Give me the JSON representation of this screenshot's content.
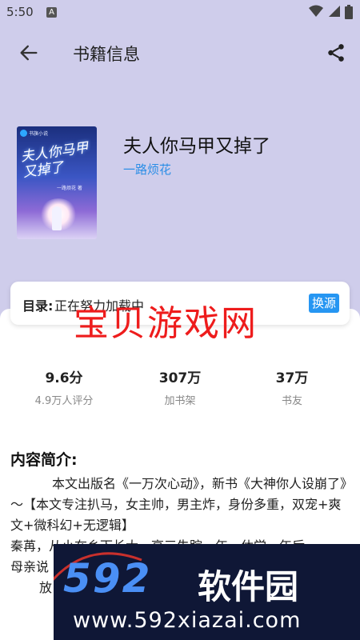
{
  "status_bar": {
    "time": "5:50",
    "notif_letter": "A"
  },
  "app_bar": {
    "title": "书籍信息"
  },
  "book": {
    "title": "夫人你马甲又掉了",
    "author": "一路烦花",
    "cover": {
      "badge_text": "书旗小说",
      "title": "夫人你马甲又掉了",
      "author": "一路烦花 著"
    }
  },
  "toc": {
    "label": "目录:",
    "status": "正在努力加载中",
    "switch_label": "换源"
  },
  "stats": [
    {
      "value": "9.6分",
      "label": "4.9万人评分"
    },
    {
      "value": "307万",
      "label": "加书架"
    },
    {
      "value": "37万",
      "label": "书友"
    }
  ],
  "intro": {
    "title": "内容简介:",
    "lines": [
      "本文出版名《一万次心动》，新书《大神你人设崩了》～【本文专注扒马，女主帅，男主炸，身份多重，双宠+爽文+微科幻+无逻辑】",
      "秦苒，从小在乡下长大，高三失踪一年，休学一年后",
      "母亲说",
      "放"
    ]
  },
  "watermarks": {
    "center": "宝贝游戏网",
    "bottom_big": "592",
    "bottom_cn": "软件园",
    "bottom_url": "www.592xiazai.com"
  },
  "colors": {
    "header_bg": "#cfcdeb",
    "accent": "#2b8ee6",
    "switch_bg": "#2696f2",
    "watermark_red": "#ee1c1c"
  }
}
